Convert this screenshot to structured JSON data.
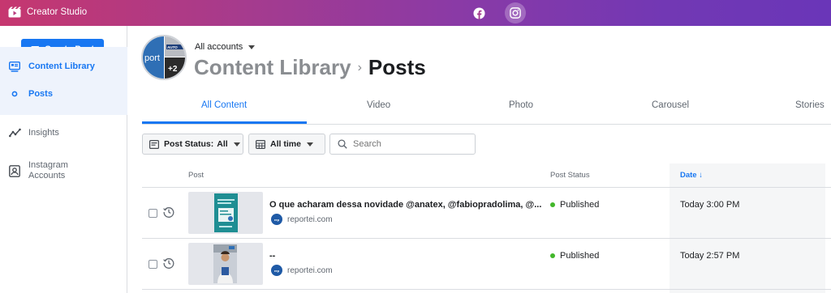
{
  "topbar": {
    "app_name": "Creator Studio",
    "platforms": [
      {
        "name": "Facebook",
        "icon": "facebook-icon"
      },
      {
        "name": "Instagram",
        "icon": "instagram-icon",
        "active": true
      }
    ],
    "gradient": [
      "#c6376f",
      "#6a36b8"
    ]
  },
  "sidebar": {
    "create_label": "Create Post",
    "items": [
      {
        "label": "Content Library",
        "icon": "content-library-icon",
        "active": true
      },
      {
        "label": "Posts",
        "icon": "dot-icon",
        "active": true
      },
      {
        "label": "Insights",
        "icon": "insights-icon"
      },
      {
        "label": "Instagram\nAccounts",
        "icon": "instagram-accounts-icon"
      }
    ]
  },
  "header": {
    "accounts_label": "All accounts",
    "avatar_text": "port",
    "avatar_badge": "+2",
    "avatar_tile_text": "AUTO",
    "breadcrumb_parent": "Content Library",
    "breadcrumb_separator": "›",
    "breadcrumb_current": "Posts"
  },
  "tabs": [
    {
      "label": "All Content",
      "active": true
    },
    {
      "label": "Video"
    },
    {
      "label": "Photo"
    },
    {
      "label": "Carousel"
    },
    {
      "label": "Stories"
    }
  ],
  "filters": {
    "status_label": "Post Status:",
    "status_value": "All",
    "time_label": "All time",
    "search_placeholder": "Search"
  },
  "table": {
    "columns": {
      "post": "Post",
      "status": "Post Status",
      "date": "Date ↓"
    },
    "rows": [
      {
        "title": "O que acharam dessa novidade @anatex, @fabiopradolima, @...",
        "source": "reportei.com",
        "status": "Published",
        "date": "Today 3:00 PM"
      },
      {
        "title": "--",
        "source": "reportei.com",
        "status": "Published",
        "date": "Today 2:57 PM"
      }
    ]
  },
  "colors": {
    "accent": "#1877f2",
    "published": "#42b72a"
  }
}
